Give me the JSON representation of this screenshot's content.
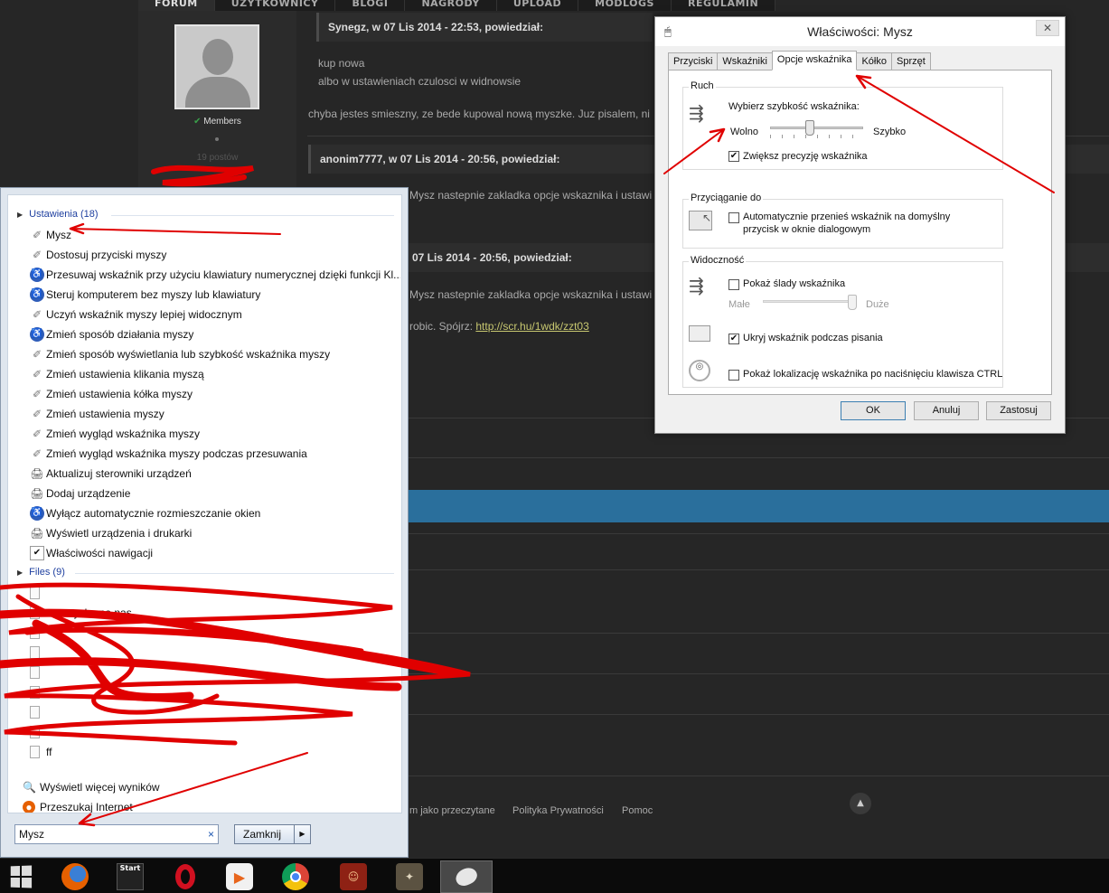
{
  "forum": {
    "nav": [
      "FORUM",
      "UŻYTKOWNICY",
      "BLOGI",
      "NAGRODY",
      "UPLOAD",
      "MODLOGS",
      "REGULAMIN"
    ],
    "profile": {
      "group": "Members",
      "posts": "19 postów"
    },
    "posts": [
      {
        "header": "Synegz, w 07 Lis 2014 - 22:53, powiedział:",
        "quote_lines": [
          "kup nowa",
          "albo w ustawieniach czulosci w widnowsie"
        ]
      },
      {
        "body": "chyba jestes smieszny, ze bede kupowal nową myszke. Juz pisalem, ni"
      },
      {
        "header": "anonim7777, w 07 Lis 2014 - 20:56, powiedział:",
        "quote_lines": [
          "Mysz nastepnie zakladka opcje wskaznika i ustawi"
        ]
      },
      {
        "header": "07 Lis 2014 - 20:56, powiedział:",
        "quote_lines": [
          "Mysz nastepnie zakladka opcje wskaznika i ustawi"
        ]
      },
      {
        "body": "robic. Spójrz:",
        "link": "http://scr.hu/1wdk/zzt03"
      }
    ],
    "footer_links": [
      "m jako przeczytane",
      "Polityka Prywatności",
      "Pomoc"
    ],
    "to_top_icon": "arrow-up-icon"
  },
  "dialog": {
    "title": "Właściwości: Mysz",
    "close": "✕",
    "tabs": [
      "Przyciski",
      "Wskaźniki",
      "Opcje wskaźnika",
      "Kółko",
      "Sprzęt"
    ],
    "active_tab": "Opcje wskaźnika",
    "motion": {
      "label": "Ruch",
      "prompt": "Wybierz szybkość wskaźnika:",
      "slow": "Wolno",
      "fast": "Szybko",
      "speed_fraction": 0.42,
      "enhance": {
        "label": "Zwiększ precyzję wskaźnika",
        "checked": true
      }
    },
    "snap": {
      "label": "Przyciąganie do",
      "option": {
        "label_line1": "Automatycznie przenieś wskaźnik na domyślny",
        "label_line2": "przycisk w oknie dialogowym",
        "checked": false
      }
    },
    "visibility": {
      "label": "Widoczność",
      "trails": {
        "label": "Pokaż ślady wskaźnika",
        "checked": false
      },
      "trail_short": "Małe",
      "trail_long": "Duże",
      "trail_fraction": 1.0,
      "hide_typing": {
        "label": "Ukryj wskaźnik podczas pisania",
        "checked": true
      },
      "ctrl_locate": {
        "label": "Pokaż lokalizację wskaźnika po naciśnięciu klawisza CTRL",
        "checked": false
      }
    },
    "buttons": {
      "ok": "OK",
      "cancel": "Anuluj",
      "apply": "Zastosuj"
    }
  },
  "start_menu": {
    "settings_header": "Ustawienia (18)",
    "settings": [
      {
        "label": "Mysz",
        "icon": "mouse-icon"
      },
      {
        "label": "Dostosuj przyciski myszy",
        "icon": "mouse-icon"
      },
      {
        "label": "Przesuwaj wskaźnik przy użyciu klawiatury numerycznej dzięki funkcji Kl...",
        "icon": "accessibility-icon"
      },
      {
        "label": "Steruj komputerem bez myszy lub klawiatury",
        "icon": "accessibility-icon"
      },
      {
        "label": "Uczyń wskaźnik myszy lepiej widocznym",
        "icon": "mouse-icon"
      },
      {
        "label": "Zmień sposób działania myszy",
        "icon": "accessibility-icon"
      },
      {
        "label": "Zmień sposób wyświetlania lub szybkość wskaźnika myszy",
        "icon": "mouse-icon"
      },
      {
        "label": "Zmień ustawienia klikania myszą",
        "icon": "mouse-icon"
      },
      {
        "label": "Zmień ustawienia kółka myszy",
        "icon": "mouse-icon"
      },
      {
        "label": "Zmień ustawienia myszy",
        "icon": "mouse-icon"
      },
      {
        "label": "Zmień wygląd wskaźnika myszy",
        "icon": "mouse-icon"
      },
      {
        "label": "Zmień wygląd wskaźnika myszy podczas przesuwania",
        "icon": "mouse-icon"
      },
      {
        "label": "Aktualizuj sterowniki urządzeń",
        "icon": "device-icon"
      },
      {
        "label": "Dodaj urządzenie",
        "icon": "device-icon"
      },
      {
        "label": "Wyłącz automatycznie rozmieszczanie okien",
        "icon": "accessibility-icon"
      },
      {
        "label": "Wyświetl urządzenia i drukarki",
        "icon": "device-icon"
      },
      {
        "label": "Właściwości nawigacji",
        "icon": "navigation-icon"
      }
    ],
    "files_header": "Files (9)",
    "files": [
      {
        "label": "",
        "icon": "file-icon"
      },
      {
        "label": "...wszyska na nas...",
        "icon": "file-icon"
      },
      {
        "label": "",
        "icon": "file-icon"
      },
      {
        "label": "",
        "icon": "file-icon"
      },
      {
        "label": "",
        "icon": "file-icon"
      },
      {
        "label": "",
        "icon": "file-icon"
      },
      {
        "label": "",
        "icon": "file-icon"
      },
      {
        "label": "",
        "icon": "file-icon"
      },
      {
        "label": "ff",
        "icon": "file-icon"
      }
    ],
    "more_results": "Wyświetl więcej wyników",
    "search_internet": "Przeszukaj Internet",
    "search_value": "Mysz",
    "clear": "×",
    "shutdown": "Zamknij"
  },
  "taskbar": {
    "start_tile_label": "Start",
    "items": [
      "windows-start-icon",
      "firefox-icon",
      "start-app-icon",
      "opera-icon",
      "media-player-icon",
      "chrome-icon",
      "game-icon",
      "game-icon",
      "mouse-icon"
    ]
  },
  "colors": {
    "accent": "#2a6f9c",
    "annotation": "#e00000",
    "link": "#c8c870"
  }
}
